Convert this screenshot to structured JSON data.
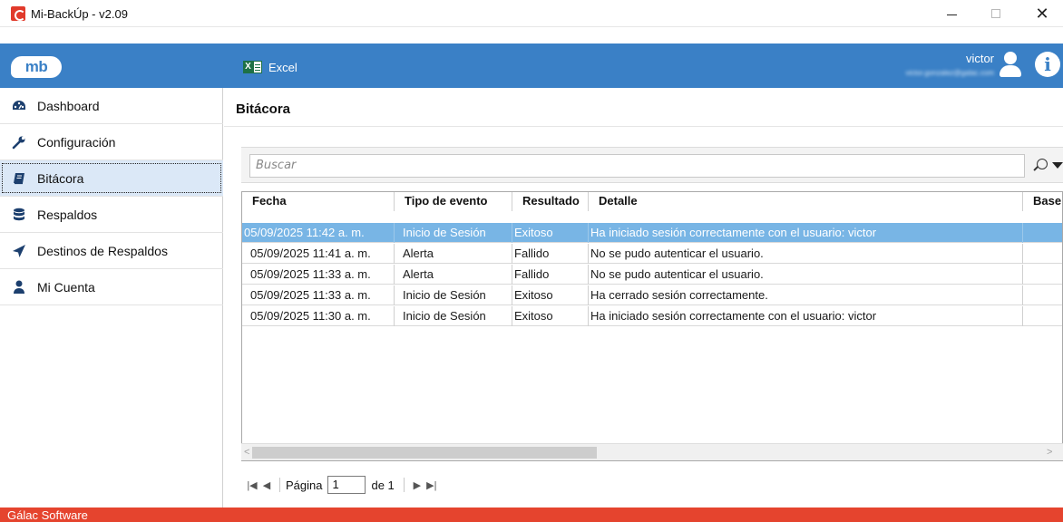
{
  "window": {
    "title": "Mi-BackÚp - v2.09"
  },
  "header": {
    "logo_text": "mb",
    "excel_label": "Excel",
    "user_name": "victor",
    "user_email": "victor.gonzalez@galac.com"
  },
  "sidebar": {
    "items": [
      {
        "label": "Dashboard",
        "icon": "dashboard-icon"
      },
      {
        "label": "Configuración",
        "icon": "wrench-icon"
      },
      {
        "label": "Bitácora",
        "icon": "book-icon",
        "active": true
      },
      {
        "label": "Respaldos",
        "icon": "database-icon"
      },
      {
        "label": "Destinos de Respaldos",
        "icon": "send-icon"
      },
      {
        "label": "Mi Cuenta",
        "icon": "user-icon"
      }
    ]
  },
  "main": {
    "title": "Bitácora",
    "search_placeholder": "Buscar",
    "columns": [
      "Fecha",
      "Tipo de evento",
      "Resultado",
      "Detalle",
      "Base"
    ],
    "rows": [
      {
        "fecha": "05/09/2025 11:42 a. m.",
        "tipo": "Inicio de Sesión",
        "resultado": "Exitoso",
        "detalle": "Ha iniciado sesión correctamente con el usuario: victor",
        "selected": true
      },
      {
        "fecha": "05/09/2025 11:41 a. m.",
        "tipo": "Alerta",
        "resultado": "Fallido",
        "detalle": "No se pudo autenticar el usuario."
      },
      {
        "fecha": "05/09/2025 11:33 a. m.",
        "tipo": "Alerta",
        "resultado": "Fallido",
        "detalle": "No se pudo autenticar el usuario."
      },
      {
        "fecha": "05/09/2025 11:33 a. m.",
        "tipo": "Inicio de Sesión",
        "resultado": "Exitoso",
        "detalle": "Ha cerrado sesión correctamente."
      },
      {
        "fecha": "05/09/2025 11:30 a. m.",
        "tipo": "Inicio de Sesión",
        "resultado": "Exitoso",
        "detalle": "Ha iniciado sesión correctamente con el usuario: victor"
      }
    ]
  },
  "pager": {
    "page_label": "Página",
    "page_value": "1",
    "of_label": "de 1"
  },
  "status": {
    "text": "Gálac Software"
  },
  "colors": {
    "header_blue": "#3a80c6",
    "selected_row": "#78b5e5",
    "status_red": "#e5442e"
  }
}
